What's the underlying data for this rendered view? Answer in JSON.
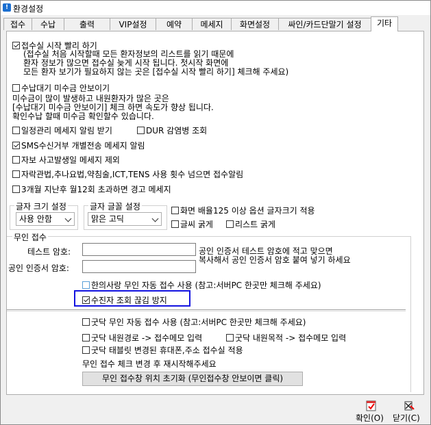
{
  "window": {
    "title": "환경설정"
  },
  "tabs": [
    "접수",
    "수납",
    "출력",
    "VIP설정",
    "예약",
    "메세지",
    "화면설정",
    "싸인/카드단말기 설정",
    "기타"
  ],
  "options": {
    "quick_start": {
      "label": "접수실 시작 빨리 하기",
      "checked": true
    },
    "quick_start_note1": "(접수실 처음 시작할때 모든 환자정보의 리스트를 읽기 때문에",
    "quick_start_note2": "환자 정보가 많으면 접수실 늦게 시작 됩니다. 첫시작 화면에",
    "quick_start_note3": "모든 환자 보기가 필요하지 않는 곳은 [접수실 시작 빨리 하기] 체크해 주세요)",
    "unpaid_warn": {
      "label": "수납대기 미수금 안보이기",
      "checked": false
    },
    "unpaid_note1": "미수금이 많이 발생하고 내원환자가 많은 곳은",
    "unpaid_note2": "[수납대기 미수금 안보이기] 체크 하면 속도가 향상 됩니다.",
    "unpaid_note3": "확인수납 할때 미수금 확인할수 있습니다.",
    "schedule_alarm": {
      "label": "일정관리 메세지 알림 받기",
      "checked": false
    },
    "dur_lookup": {
      "label": "DUR 감염병 조회",
      "checked": false
    },
    "sms_reject": {
      "label": "SMS수신거부 개별전송 메세지 알림",
      "checked": true
    },
    "car_accident": {
      "label": "자보 사고발생일 메세지 제외",
      "checked": false
    },
    "self_acup": {
      "label": "자락관법,추나요법,약침술,ICT,TENS 사용 횟수 넘으면 접수알림",
      "checked": false
    },
    "three_month": {
      "label": "3개월 지난후 월12회 초과하면 경고 메세지",
      "checked": false
    }
  },
  "font_size": {
    "label": "글자 크기 설정",
    "value": "사용 안함"
  },
  "font_face": {
    "label": "글자 글꼴 설정",
    "value": "맑은 고딕"
  },
  "display_opts": {
    "zoom125": {
      "label": "화면 배율125 이상  옵션 글자크기 적용",
      "checked": false
    },
    "bold_text": {
      "label": "글씨 굵게",
      "checked": false
    },
    "bold_list": {
      "label": "리스트 굵게",
      "checked": false
    }
  },
  "unmanned": {
    "section_label": "무인 접수",
    "test_pw_label": "테스트 암호:",
    "test_pw_value": "",
    "cert_pw_label": "공인 인증서 암호:",
    "cert_pw_value": "",
    "cert_note1": "공인 인증서 테스트 암호에 적고 맞으면",
    "cert_note2": "복사해서 공인 인증서 암호 붙여 넣기 하세요",
    "oriental": {
      "label": "한의사랑 무인 자동 접수 사용 (참고:서버PC 한곳만 체크해 주세요)",
      "checked": false
    },
    "block_lookup": {
      "label": "수진자 조회  끊김 방지",
      "checked": true
    },
    "gutdak_auto": {
      "label": "굿닥 무인 자동 접수 사용 (참고:서버PC 한곳만 체크해 주세요)",
      "checked": false
    },
    "gutdak_route": {
      "label": "굿닥 내원경로 -> 접수메모 입력",
      "checked": false
    },
    "gutdak_purpose": {
      "label": "굿닥 내원목적 -> 접수메모 입력",
      "checked": false
    },
    "gutdak_tablet": {
      "label": "굿닥 태블릿 변경된 휴대폰,주소 접수실 적용",
      "checked": false
    },
    "restart_note": "무인 접수 체크 변경 후 재시작해주세요",
    "reset_button": "무인 접수창 위치 초기화 (무인접수창  안보이면 클릭)"
  },
  "footer": {
    "ok_label": "확인(O)",
    "close_label": "닫기(C)"
  },
  "colors": {
    "highlight_border": "#1212e0",
    "checkbox_blue": "#5aa0d8"
  }
}
